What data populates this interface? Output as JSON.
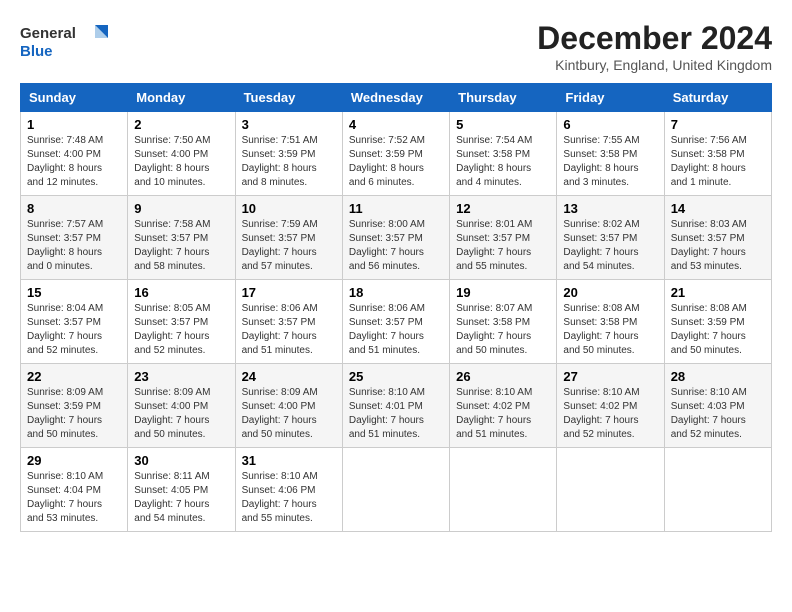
{
  "header": {
    "logo_line1": "General",
    "logo_line2": "Blue",
    "month_title": "December 2024",
    "subtitle": "Kintbury, England, United Kingdom"
  },
  "days_of_week": [
    "Sunday",
    "Monday",
    "Tuesday",
    "Wednesday",
    "Thursday",
    "Friday",
    "Saturday"
  ],
  "weeks": [
    [
      {
        "day": "1",
        "sunrise": "Sunrise: 7:48 AM",
        "sunset": "Sunset: 4:00 PM",
        "daylight": "Daylight: 8 hours and 12 minutes."
      },
      {
        "day": "2",
        "sunrise": "Sunrise: 7:50 AM",
        "sunset": "Sunset: 4:00 PM",
        "daylight": "Daylight: 8 hours and 10 minutes."
      },
      {
        "day": "3",
        "sunrise": "Sunrise: 7:51 AM",
        "sunset": "Sunset: 3:59 PM",
        "daylight": "Daylight: 8 hours and 8 minutes."
      },
      {
        "day": "4",
        "sunrise": "Sunrise: 7:52 AM",
        "sunset": "Sunset: 3:59 PM",
        "daylight": "Daylight: 8 hours and 6 minutes."
      },
      {
        "day": "5",
        "sunrise": "Sunrise: 7:54 AM",
        "sunset": "Sunset: 3:58 PM",
        "daylight": "Daylight: 8 hours and 4 minutes."
      },
      {
        "day": "6",
        "sunrise": "Sunrise: 7:55 AM",
        "sunset": "Sunset: 3:58 PM",
        "daylight": "Daylight: 8 hours and 3 minutes."
      },
      {
        "day": "7",
        "sunrise": "Sunrise: 7:56 AM",
        "sunset": "Sunset: 3:58 PM",
        "daylight": "Daylight: 8 hours and 1 minute."
      }
    ],
    [
      {
        "day": "8",
        "sunrise": "Sunrise: 7:57 AM",
        "sunset": "Sunset: 3:57 PM",
        "daylight": "Daylight: 8 hours and 0 minutes."
      },
      {
        "day": "9",
        "sunrise": "Sunrise: 7:58 AM",
        "sunset": "Sunset: 3:57 PM",
        "daylight": "Daylight: 7 hours and 58 minutes."
      },
      {
        "day": "10",
        "sunrise": "Sunrise: 7:59 AM",
        "sunset": "Sunset: 3:57 PM",
        "daylight": "Daylight: 7 hours and 57 minutes."
      },
      {
        "day": "11",
        "sunrise": "Sunrise: 8:00 AM",
        "sunset": "Sunset: 3:57 PM",
        "daylight": "Daylight: 7 hours and 56 minutes."
      },
      {
        "day": "12",
        "sunrise": "Sunrise: 8:01 AM",
        "sunset": "Sunset: 3:57 PM",
        "daylight": "Daylight: 7 hours and 55 minutes."
      },
      {
        "day": "13",
        "sunrise": "Sunrise: 8:02 AM",
        "sunset": "Sunset: 3:57 PM",
        "daylight": "Daylight: 7 hours and 54 minutes."
      },
      {
        "day": "14",
        "sunrise": "Sunrise: 8:03 AM",
        "sunset": "Sunset: 3:57 PM",
        "daylight": "Daylight: 7 hours and 53 minutes."
      }
    ],
    [
      {
        "day": "15",
        "sunrise": "Sunrise: 8:04 AM",
        "sunset": "Sunset: 3:57 PM",
        "daylight": "Daylight: 7 hours and 52 minutes."
      },
      {
        "day": "16",
        "sunrise": "Sunrise: 8:05 AM",
        "sunset": "Sunset: 3:57 PM",
        "daylight": "Daylight: 7 hours and 52 minutes."
      },
      {
        "day": "17",
        "sunrise": "Sunrise: 8:06 AM",
        "sunset": "Sunset: 3:57 PM",
        "daylight": "Daylight: 7 hours and 51 minutes."
      },
      {
        "day": "18",
        "sunrise": "Sunrise: 8:06 AM",
        "sunset": "Sunset: 3:57 PM",
        "daylight": "Daylight: 7 hours and 51 minutes."
      },
      {
        "day": "19",
        "sunrise": "Sunrise: 8:07 AM",
        "sunset": "Sunset: 3:58 PM",
        "daylight": "Daylight: 7 hours and 50 minutes."
      },
      {
        "day": "20",
        "sunrise": "Sunrise: 8:08 AM",
        "sunset": "Sunset: 3:58 PM",
        "daylight": "Daylight: 7 hours and 50 minutes."
      },
      {
        "day": "21",
        "sunrise": "Sunrise: 8:08 AM",
        "sunset": "Sunset: 3:59 PM",
        "daylight": "Daylight: 7 hours and 50 minutes."
      }
    ],
    [
      {
        "day": "22",
        "sunrise": "Sunrise: 8:09 AM",
        "sunset": "Sunset: 3:59 PM",
        "daylight": "Daylight: 7 hours and 50 minutes."
      },
      {
        "day": "23",
        "sunrise": "Sunrise: 8:09 AM",
        "sunset": "Sunset: 4:00 PM",
        "daylight": "Daylight: 7 hours and 50 minutes."
      },
      {
        "day": "24",
        "sunrise": "Sunrise: 8:09 AM",
        "sunset": "Sunset: 4:00 PM",
        "daylight": "Daylight: 7 hours and 50 minutes."
      },
      {
        "day": "25",
        "sunrise": "Sunrise: 8:10 AM",
        "sunset": "Sunset: 4:01 PM",
        "daylight": "Daylight: 7 hours and 51 minutes."
      },
      {
        "day": "26",
        "sunrise": "Sunrise: 8:10 AM",
        "sunset": "Sunset: 4:02 PM",
        "daylight": "Daylight: 7 hours and 51 minutes."
      },
      {
        "day": "27",
        "sunrise": "Sunrise: 8:10 AM",
        "sunset": "Sunset: 4:02 PM",
        "daylight": "Daylight: 7 hours and 52 minutes."
      },
      {
        "day": "28",
        "sunrise": "Sunrise: 8:10 AM",
        "sunset": "Sunset: 4:03 PM",
        "daylight": "Daylight: 7 hours and 52 minutes."
      }
    ],
    [
      {
        "day": "29",
        "sunrise": "Sunrise: 8:10 AM",
        "sunset": "Sunset: 4:04 PM",
        "daylight": "Daylight: 7 hours and 53 minutes."
      },
      {
        "day": "30",
        "sunrise": "Sunrise: 8:11 AM",
        "sunset": "Sunset: 4:05 PM",
        "daylight": "Daylight: 7 hours and 54 minutes."
      },
      {
        "day": "31",
        "sunrise": "Sunrise: 8:10 AM",
        "sunset": "Sunset: 4:06 PM",
        "daylight": "Daylight: 7 hours and 55 minutes."
      },
      null,
      null,
      null,
      null
    ]
  ]
}
